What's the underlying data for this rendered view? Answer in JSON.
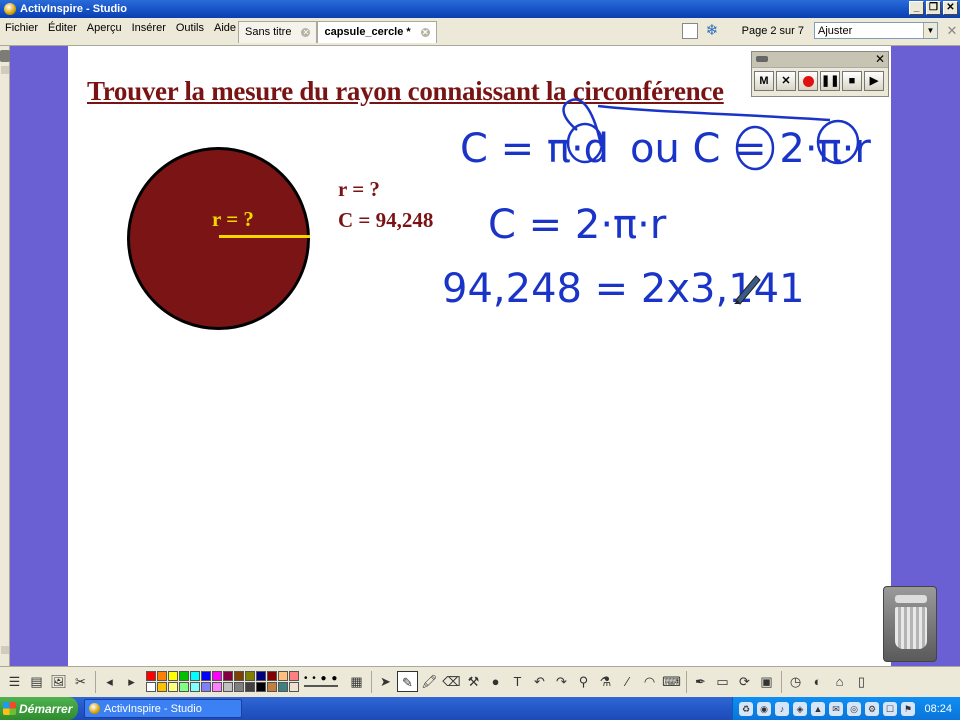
{
  "window": {
    "title": "ActivInspire - Studio"
  },
  "menu": {
    "items": [
      "Fichier",
      "Éditer",
      "Aperçu",
      "Insérer",
      "Outils",
      "Aide"
    ]
  },
  "tabs": [
    {
      "label": "Sans titre",
      "active": false
    },
    {
      "label": "capsule_cercle *",
      "active": true
    }
  ],
  "pager": {
    "label": "Page 2 sur 7",
    "zoom_value": "Ajuster"
  },
  "slide": {
    "title": "Trouver la mesure du rayon connaissant la circonférence",
    "radius_label": "r = ?",
    "given_r": "r = ?",
    "given_c": "C = 94,248",
    "handwriting": {
      "line1_part1": "C = π·d",
      "line1_part2": "ou C = 2·π·r",
      "line2": "C = 2·π·r",
      "line3": "94,248 = 2x3,141"
    },
    "colors": {
      "title": "#7a1414",
      "circle_fill": "#7b1515",
      "radius_line": "#f4d800",
      "ink": "#1a34c8",
      "background": "#6a60d3"
    }
  },
  "recorder": {
    "buttons": [
      "M",
      "✕",
      "record",
      "❚❚",
      "■",
      "▶"
    ]
  },
  "toolbar": {
    "palette": [
      "#ff0000",
      "#ff8000",
      "#ffff00",
      "#00c000",
      "#00ffff",
      "#0000ff",
      "#ff00ff",
      "#800040",
      "#804000",
      "#808000",
      "#000080",
      "#800000",
      "#ffc080",
      "#ff8080",
      "#ffffff",
      "#ffc000",
      "#ffff80",
      "#80ff80",
      "#80ffff",
      "#8080ff",
      "#ff80ff",
      "#c0c0c0",
      "#808080",
      "#404040",
      "#000000",
      "#c08040",
      "#408080",
      "#f0e0d0"
    ]
  },
  "taskbar": {
    "start_label": "Démarrer",
    "task_label": "ActivInspire - Studio",
    "clock": "08:24"
  }
}
